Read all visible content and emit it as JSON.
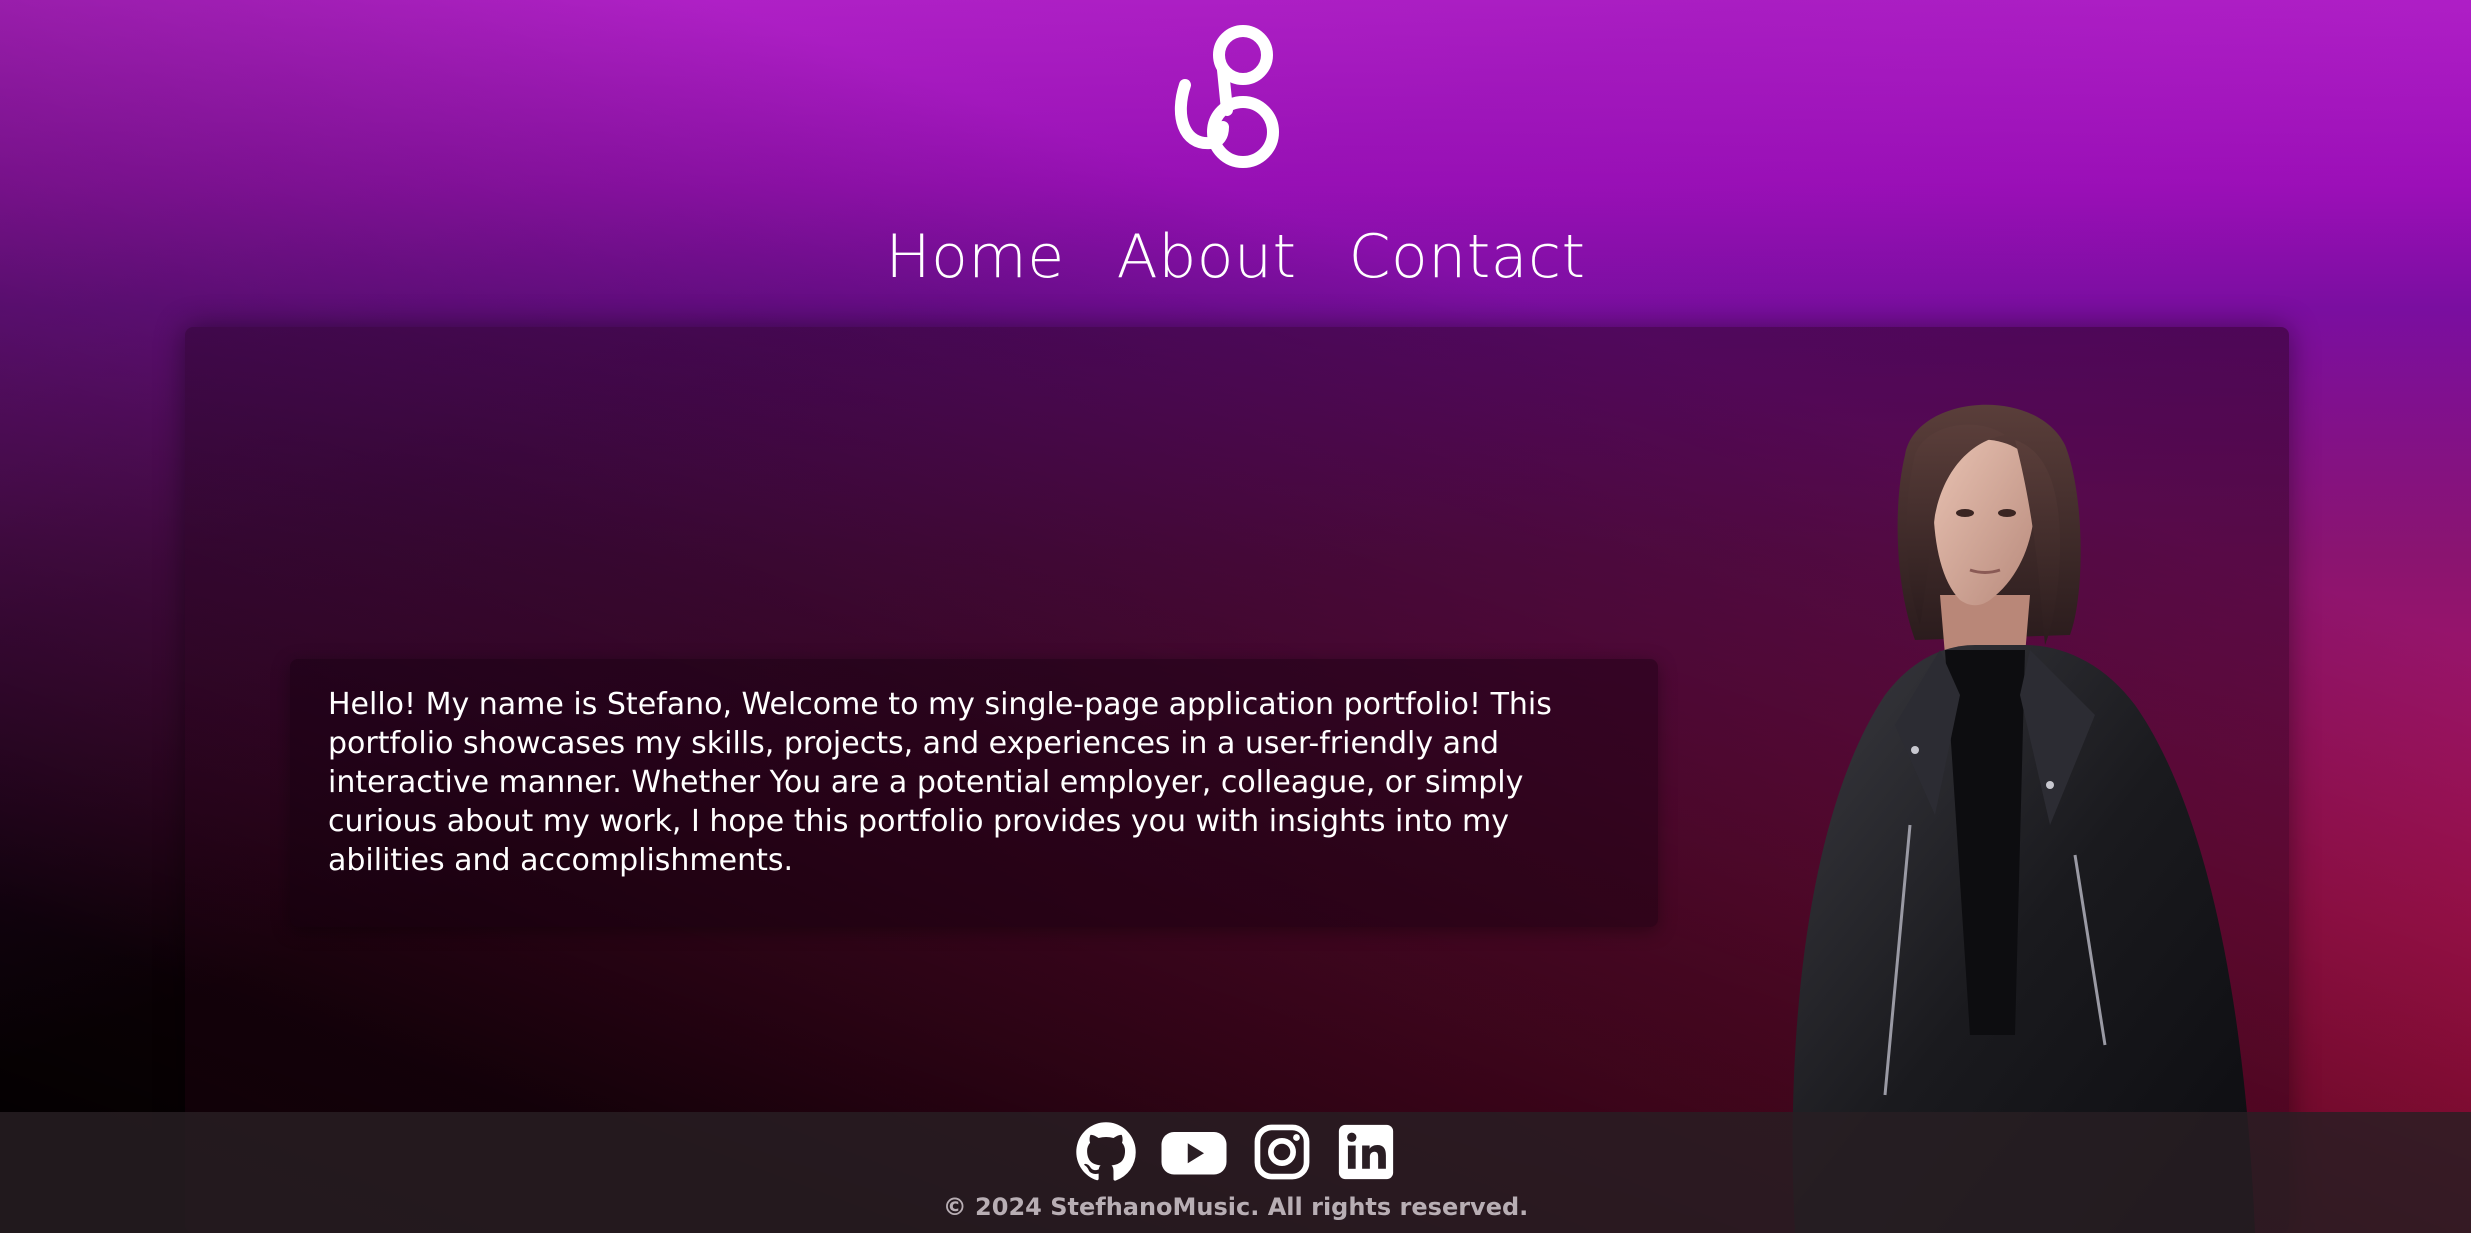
{
  "brand": {
    "logo_icon": "brand-monogram-icon"
  },
  "nav": {
    "items": [
      {
        "label": "Home"
      },
      {
        "label": "About"
      },
      {
        "label": "Contact"
      }
    ]
  },
  "intro": {
    "text": "Hello! My name is Stefano, Welcome to my single-page application portfolio! This portfolio showcases my skills, projects, and experiences in a user-friendly and interactive manner. Whether You are a potential employer, colleague, or simply curious about my work, I hope this portfolio provides you with insights into my abilities and accomplishments."
  },
  "portrait": {
    "icon": "portrait-photo"
  },
  "footer": {
    "social": [
      {
        "name": "github",
        "icon": "github-icon"
      },
      {
        "name": "youtube",
        "icon": "youtube-icon"
      },
      {
        "name": "instagram",
        "icon": "instagram-icon"
      },
      {
        "name": "linkedin",
        "icon": "linkedin-icon"
      }
    ],
    "copyright": "© 2024 StefhanoMusic. All rights reserved."
  },
  "colors": {
    "gradient_top": "#b21fc8",
    "gradient_bottom": "#e0134e",
    "footer_bg": "#2a1e24",
    "text": "#ffffff",
    "muted_text": "#b8aeb4"
  }
}
